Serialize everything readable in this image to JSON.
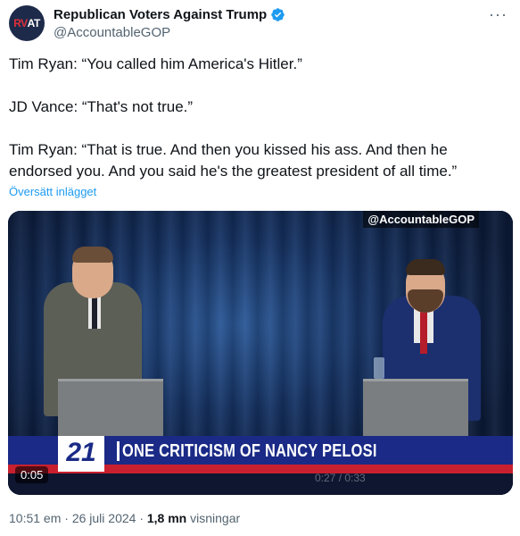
{
  "author": {
    "name": "Republican Voters Against Trump",
    "handle": "@AccountableGOP",
    "avatar_text": "RVAT",
    "verified": true
  },
  "menu_icon": "more-horizontal-icon",
  "tweet": {
    "line1": "Tim Ryan: “You called him America's Hitler.”",
    "line2": "JD Vance: “That's not true.”",
    "line3": "Tim Ryan: “That is true. And then you kissed his ass. And then he endorsed you. And you said he's the greatest president of all time.”"
  },
  "translate_label": "Översätt inlägget",
  "video": {
    "watermark": "@AccountableGOP",
    "channel_logo": "21",
    "headline": "ONE CRITICISM OF NANCY PELOSI",
    "duration_badge": "0:05",
    "progress_text": "0:27 / 0:33"
  },
  "footer": {
    "time_date": "10:51 em · 26 juli 2024 · ",
    "views_count": "1,8 mn",
    "views_label": " visningar"
  },
  "colors": {
    "link": "#1d9bf0",
    "verified": "#1d9bf0",
    "secondary_text": "#536471"
  }
}
